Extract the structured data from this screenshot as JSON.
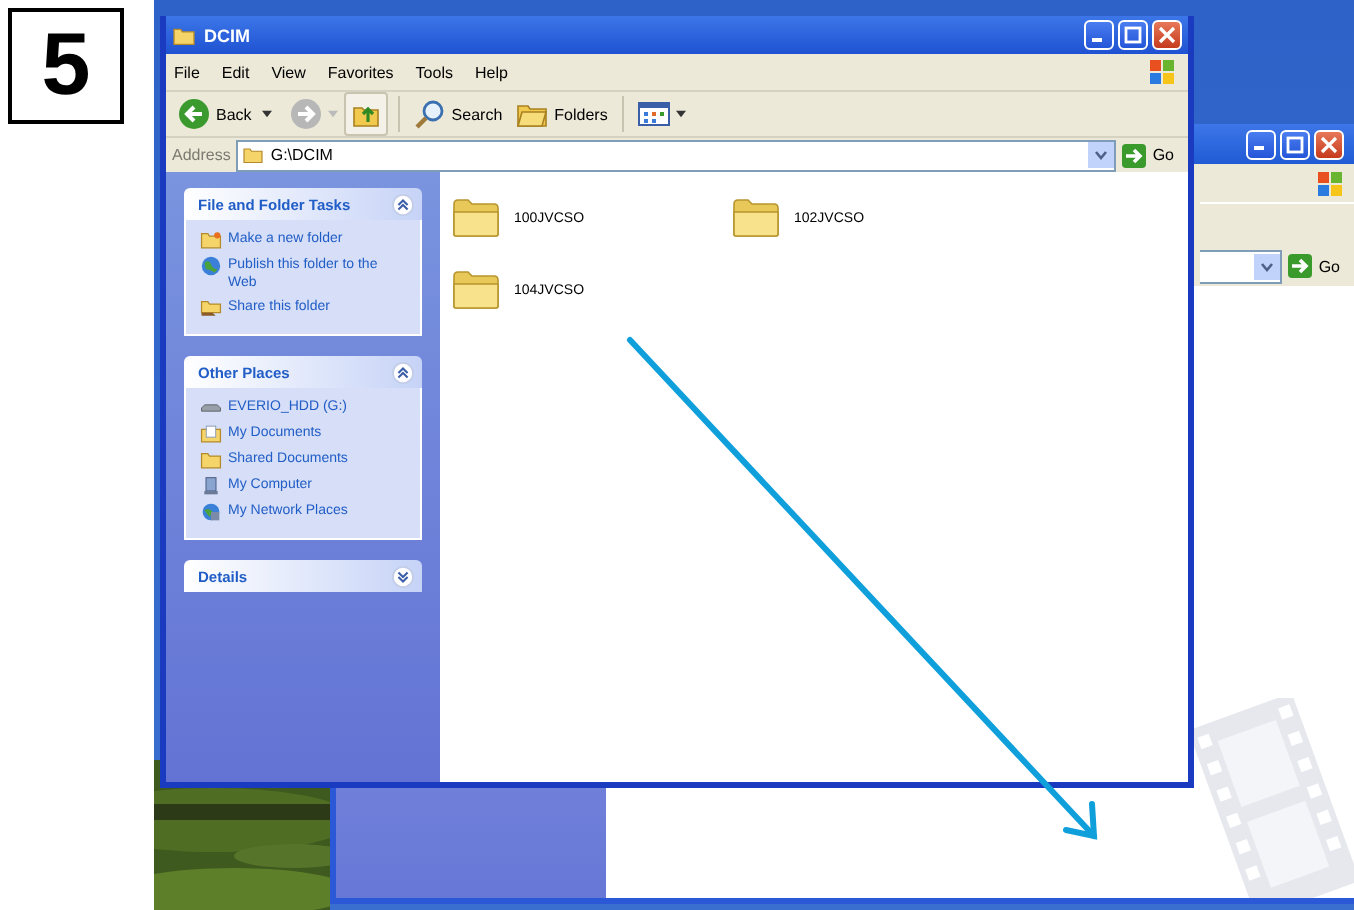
{
  "step": "5",
  "back_window": {
    "go": "Go"
  },
  "window": {
    "title": "DCIM",
    "menu": [
      "File",
      "Edit",
      "View",
      "Favorites",
      "Tools",
      "Help"
    ],
    "toolbar": {
      "back": "Back",
      "search": "Search",
      "folders": "Folders"
    },
    "address": {
      "label": "Address",
      "value": "G:\\DCIM",
      "go": "Go"
    },
    "task_panels": [
      {
        "title": "File and Folder Tasks",
        "expanded": true,
        "items": [
          {
            "kind": "newfolder",
            "label": "Make a new folder"
          },
          {
            "kind": "globe",
            "label": "Publish this folder to the Web"
          },
          {
            "kind": "share",
            "label": "Share this folder"
          }
        ]
      },
      {
        "title": "Other Places",
        "expanded": true,
        "items": [
          {
            "kind": "drive",
            "label": "EVERIO_HDD (G:)"
          },
          {
            "kind": "documents",
            "label": "My Documents"
          },
          {
            "kind": "folder",
            "label": "Shared Documents"
          },
          {
            "kind": "computer",
            "label": "My Computer"
          },
          {
            "kind": "network",
            "label": "My Network Places"
          }
        ]
      },
      {
        "title": "Details",
        "expanded": false
      }
    ],
    "folders": [
      {
        "name": "100JVCSO"
      },
      {
        "name": "102JVCSO"
      },
      {
        "name": "104JVCSO"
      }
    ]
  }
}
